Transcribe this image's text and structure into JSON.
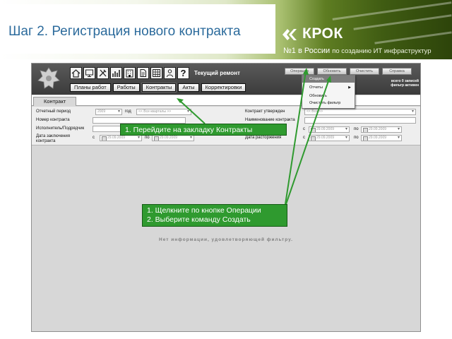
{
  "slide": {
    "title": "Шаг 2. Регистрация нового контракта",
    "logo_text": "КРОК",
    "tagline_main": "№1 в России",
    "tagline_sub": "по созданию ИТ инфраструктур"
  },
  "app": {
    "toolbar_icons": [
      "home-icon",
      "monitor-icon",
      "tools-icon",
      "chart-icon",
      "building-icon",
      "document-icon",
      "grid-icon",
      "person-icon",
      "help-icon"
    ],
    "help_glyph": "?",
    "section_title": "Текущий ремонт",
    "nav_tabs": [
      "Планы работ",
      "Работы",
      "Контракты",
      "Акты",
      "Корректировки"
    ],
    "top_buttons": [
      "Операции",
      "Обновить",
      "Очистить",
      "Справка"
    ],
    "record_info": "всего 0 записей\nфильтр активен",
    "operations_menu": {
      "items": [
        "Создать",
        "Отчеты",
        "Обновить",
        "Очистить фильтр"
      ],
      "highlighted": "Создать"
    },
    "sub_tab": "Контракт",
    "filters": {
      "period_label": "Отчетный период",
      "year_value": "2009",
      "year_label": "год",
      "quarter_value": "<< Все кварталы >>",
      "contract_no_label": "Номер контракта",
      "contractor_label": "Исполнитель/Подрядчик",
      "conclusion_date_label": "Дата заключения контракта",
      "from_label": "с",
      "to_label": "по",
      "date_from": "29.09.2009",
      "date_to": "29.09.2009",
      "approved_label": "Контракт утвержден",
      "approved_value": "<< Все >>",
      "contract_name_label": "Наименование контракта",
      "termination_date_label": "Дата расторжения"
    },
    "empty_message": "Нет информации, удовлетворяющей фильтру."
  },
  "callouts": {
    "first": "1. Перейдите на закладку Контракты",
    "second_line1": "1. Щелкните по кнопке Операции",
    "second_line2": "2. Выберите команду Создать"
  },
  "colors": {
    "title_blue": "#2c6b9c",
    "callout_green": "#2f9a2f",
    "header_dark": "#3b3b3b"
  }
}
